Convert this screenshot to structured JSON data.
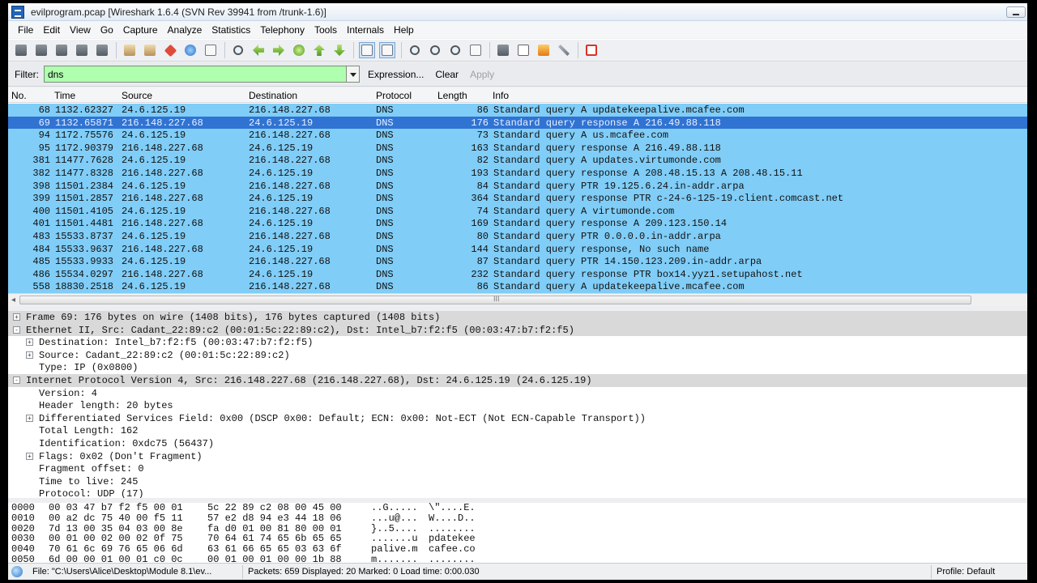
{
  "window": {
    "title": "evilprogram.pcap   [Wireshark 1.6.4  (SVN Rev 39941 from /trunk-1.6)]"
  },
  "menu": [
    "File",
    "Edit",
    "View",
    "Go",
    "Capture",
    "Analyze",
    "Statistics",
    "Telephony",
    "Tools",
    "Internals",
    "Help"
  ],
  "filter": {
    "label": "Filter:",
    "value": "dns",
    "expression": "Expression...",
    "clear": "Clear",
    "apply": "Apply"
  },
  "packet_list": {
    "columns": {
      "no": "No.",
      "time": "Time",
      "source": "Source",
      "destination": "Destination",
      "protocol": "Protocol",
      "length": "Length",
      "info": "Info"
    },
    "rows": [
      {
        "no": "68",
        "time": "1132.62327",
        "src": "24.6.125.19",
        "dst": "216.148.227.68",
        "proto": "DNS",
        "len": "86",
        "info": "Standard query A updatekeepalive.mcafee.com"
      },
      {
        "no": "69",
        "time": "1132.65871",
        "src": "216.148.227.68",
        "dst": "24.6.125.19",
        "proto": "DNS",
        "len": "176",
        "info": "Standard query response A 216.49.88.118"
      },
      {
        "no": "94",
        "time": "1172.75576",
        "src": "24.6.125.19",
        "dst": "216.148.227.68",
        "proto": "DNS",
        "len": "73",
        "info": "Standard query A us.mcafee.com"
      },
      {
        "no": "95",
        "time": "1172.90379",
        "src": "216.148.227.68",
        "dst": "24.6.125.19",
        "proto": "DNS",
        "len": "163",
        "info": "Standard query response A 216.49.88.118"
      },
      {
        "no": "381",
        "time": "11477.7628",
        "src": "24.6.125.19",
        "dst": "216.148.227.68",
        "proto": "DNS",
        "len": "82",
        "info": "Standard query A updates.virtumonde.com"
      },
      {
        "no": "382",
        "time": "11477.8328",
        "src": "216.148.227.68",
        "dst": "24.6.125.19",
        "proto": "DNS",
        "len": "193",
        "info": "Standard query response A 208.48.15.13 A 208.48.15.11"
      },
      {
        "no": "398",
        "time": "11501.2384",
        "src": "24.6.125.19",
        "dst": "216.148.227.68",
        "proto": "DNS",
        "len": "84",
        "info": "Standard query PTR 19.125.6.24.in-addr.arpa"
      },
      {
        "no": "399",
        "time": "11501.2857",
        "src": "216.148.227.68",
        "dst": "24.6.125.19",
        "proto": "DNS",
        "len": "364",
        "info": "Standard query response PTR c-24-6-125-19.client.comcast.net"
      },
      {
        "no": "400",
        "time": "11501.4105",
        "src": "24.6.125.19",
        "dst": "216.148.227.68",
        "proto": "DNS",
        "len": "74",
        "info": "Standard query A virtumonde.com"
      },
      {
        "no": "401",
        "time": "11501.4481",
        "src": "216.148.227.68",
        "dst": "24.6.125.19",
        "proto": "DNS",
        "len": "169",
        "info": "Standard query response A 209.123.150.14"
      },
      {
        "no": "483",
        "time": "15533.8737",
        "src": "24.6.125.19",
        "dst": "216.148.227.68",
        "proto": "DNS",
        "len": "80",
        "info": "Standard query PTR 0.0.0.0.in-addr.arpa"
      },
      {
        "no": "484",
        "time": "15533.9637",
        "src": "216.148.227.68",
        "dst": "24.6.125.19",
        "proto": "DNS",
        "len": "144",
        "info": "Standard query response, No such name"
      },
      {
        "no": "485",
        "time": "15533.9933",
        "src": "24.6.125.19",
        "dst": "216.148.227.68",
        "proto": "DNS",
        "len": "87",
        "info": "Standard query PTR 14.150.123.209.in-addr.arpa"
      },
      {
        "no": "486",
        "time": "15534.0297",
        "src": "216.148.227.68",
        "dst": "24.6.125.19",
        "proto": "DNS",
        "len": "232",
        "info": "Standard query response PTR box14.yyz1.setupahost.net"
      },
      {
        "no": "558",
        "time": "18830.2518",
        "src": "24.6.125.19",
        "dst": "216.148.227.68",
        "proto": "DNS",
        "len": "86",
        "info": "Standard query A updatekeepalive.mcafee.com"
      }
    ]
  },
  "details": [
    {
      "text": "Frame 69: 176 bytes on wire (1408 bits), 176 bytes captured (1408 bits)",
      "expander": "+"
    },
    {
      "text": "Ethernet II, Src: Cadant_22:89:c2 (00:01:5c:22:89:c2), Dst: Intel_b7:f2:f5 (00:03:47:b7:f2:f5)",
      "expander": "-"
    },
    {
      "text": "Destination: Intel_b7:f2:f5 (00:03:47:b7:f2:f5)",
      "expander": "+"
    },
    {
      "text": "Source: Cadant_22:89:c2 (00:01:5c:22:89:c2)",
      "expander": "+"
    },
    {
      "text": "Type: IP (0x0800)",
      "expander": ""
    },
    {
      "text": "Internet Protocol Version 4, Src: 216.148.227.68 (216.148.227.68), Dst: 24.6.125.19 (24.6.125.19)",
      "expander": "-"
    },
    {
      "text": "Version: 4",
      "expander": ""
    },
    {
      "text": "Header length: 20 bytes",
      "expander": ""
    },
    {
      "text": "Differentiated Services Field: 0x00 (DSCP 0x00: Default; ECN: 0x00: Not-ECT (Not ECN-Capable Transport))",
      "expander": "+"
    },
    {
      "text": "Total Length: 162",
      "expander": ""
    },
    {
      "text": "Identification: 0xdc75 (56437)",
      "expander": ""
    },
    {
      "text": "Flags: 0x02 (Don't Fragment)",
      "expander": "+"
    },
    {
      "text": "Fragment offset: 0",
      "expander": ""
    },
    {
      "text": "Time to live: 245",
      "expander": ""
    },
    {
      "text": "Protocol: UDP (17)",
      "expander": ""
    }
  ],
  "hex": [
    {
      "off": "0000",
      "b1": "00 03 47 b7 f2 f5 00 01",
      "b2": "5c 22 89 c2 08 00 45 00",
      "a1": "..G.....",
      "a2": "\\\"....E."
    },
    {
      "off": "0010",
      "b1": "00 a2 dc 75 40 00 f5 11",
      "b2": "57 e2 d8 94 e3 44 18 06",
      "a1": "...u@...",
      "a2": "W....D.."
    },
    {
      "off": "0020",
      "b1": "7d 13 00 35 04 03 00 8e",
      "b2": "fa d0 01 00 81 80 00 01",
      "a1": "}..5....",
      "a2": "........"
    },
    {
      "off": "0030",
      "b1": "00 01 00 02 00 02 0f 75",
      "b2": "70 64 61 74 65 6b 65 65",
      "a1": ".......u",
      "a2": "pdatekee"
    },
    {
      "off": "0040",
      "b1": "70 61 6c 69 76 65 06 6d",
      "b2": "63 61 66 65 65 03 63 6f",
      "a1": "palive.m",
      "a2": "cafee.co"
    },
    {
      "off": "0050",
      "b1": "6d 00 00 01 00 01 c0 0c",
      "b2": "00 01 00 01 00 00 1b 88",
      "a1": "m.......",
      "a2": "........"
    }
  ],
  "status": {
    "file": "File: \"C:\\Users\\Alice\\Desktop\\Module 8.1\\ev...",
    "packets": "Packets: 659 Displayed: 20 Marked: 0 Load time: 0:00.030",
    "profile": "Profile: Default"
  }
}
